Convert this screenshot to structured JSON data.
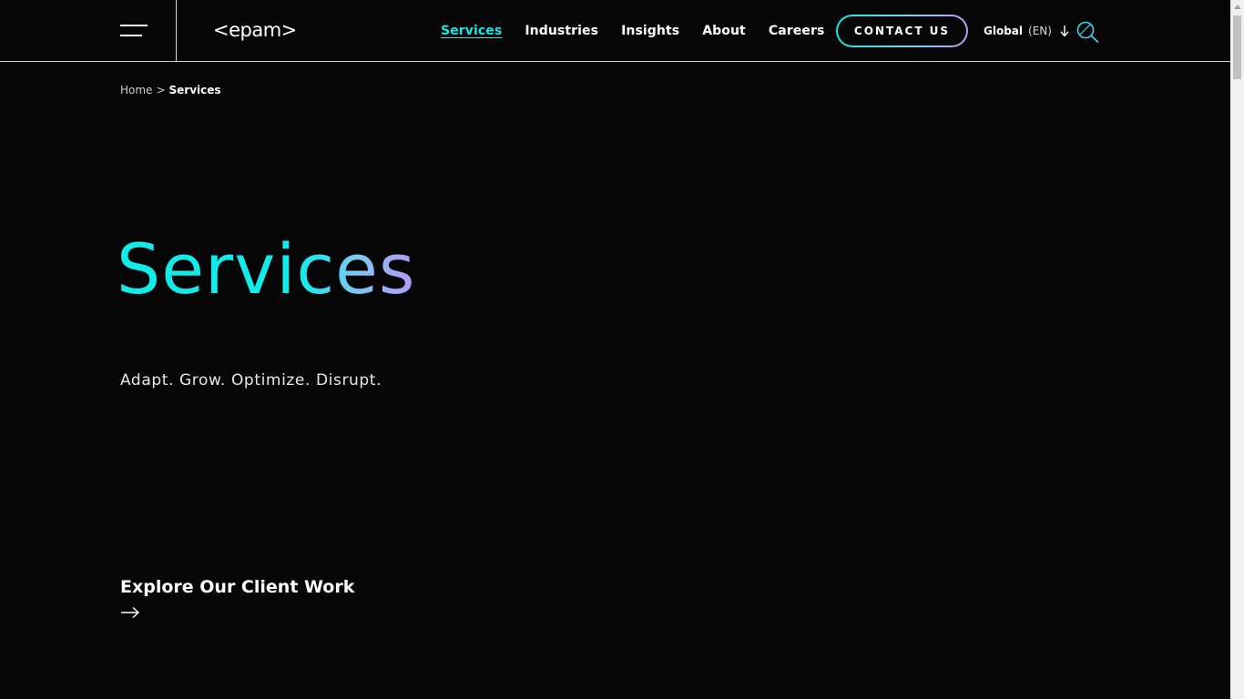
{
  "header": {
    "logo_text": "<epam>",
    "nav": [
      {
        "label": "Services",
        "active": true
      },
      {
        "label": "Industries",
        "active": false
      },
      {
        "label": "Insights",
        "active": false
      },
      {
        "label": "About",
        "active": false
      },
      {
        "label": "Careers",
        "active": false
      }
    ],
    "contact_label": "CONTACT US",
    "language": {
      "region": "Global",
      "code": "(EN)"
    },
    "icons": [
      "menu-icon",
      "chevron-down-icon",
      "search-icon"
    ]
  },
  "breadcrumb": {
    "home": "Home",
    "separator": ">",
    "current": "Services"
  },
  "hero": {
    "title": "Services",
    "tagline": "Adapt. Grow. Optimize. Disrupt."
  },
  "explore": {
    "label": "Explore Our Client Work",
    "icon": "arrow-right-icon"
  },
  "colors": {
    "background": "#060606",
    "accent_cyan": "#14e6e6",
    "accent_purple": "#b79cf5",
    "text": "#ffffff"
  }
}
